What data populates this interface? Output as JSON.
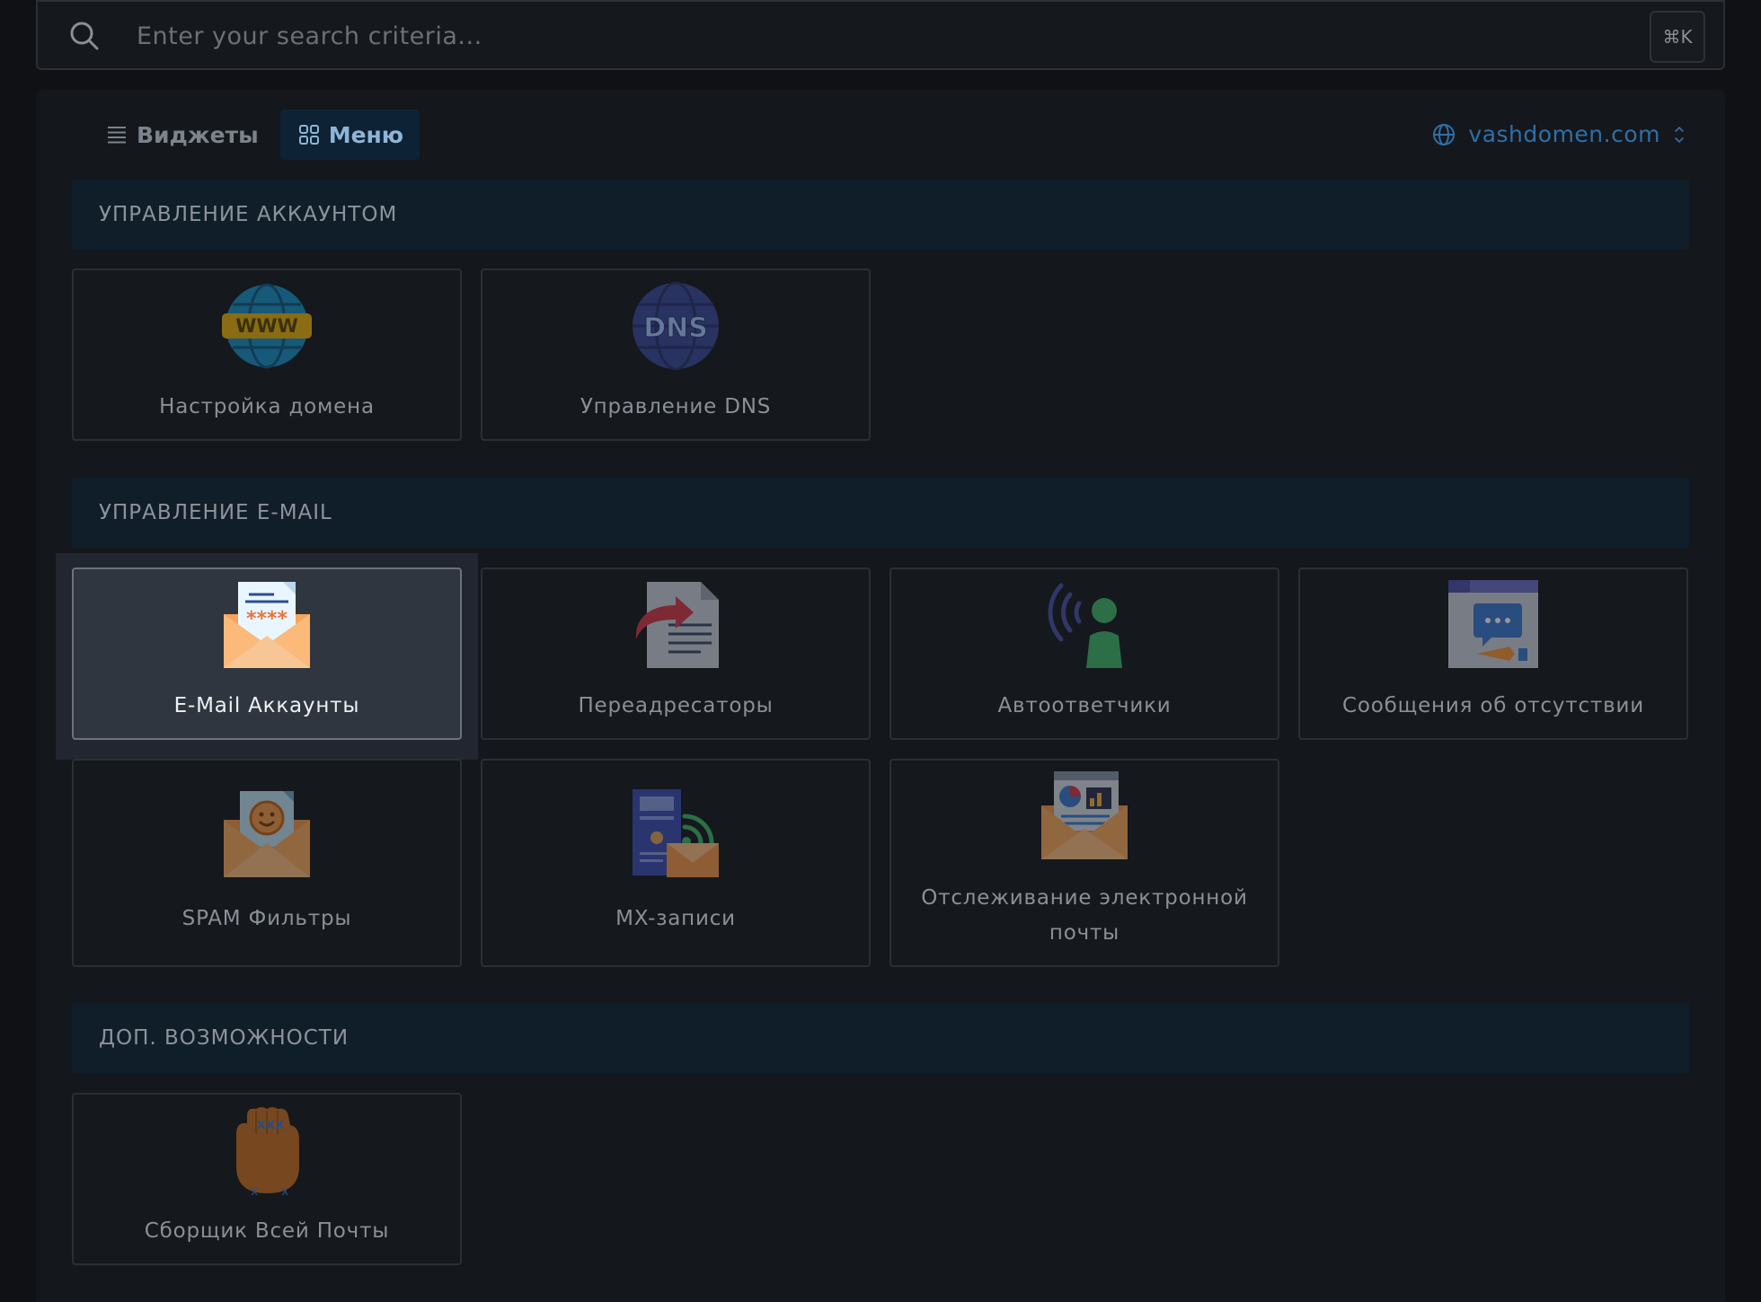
{
  "search": {
    "placeholder": "Enter your search criteria...",
    "shortcut": "⌘K"
  },
  "view_tabs": [
    {
      "label": "Виджеты",
      "icon": "list-icon",
      "active": false
    },
    {
      "label": "Меню",
      "icon": "grid-icon",
      "active": true
    }
  ],
  "domain_selector": {
    "label": "vashdomen.com",
    "icon": "globe-icon"
  },
  "sections": [
    {
      "title": "УПРАВЛЕНИЕ АККАУНТОМ",
      "items": [
        {
          "label": "Настройка домена",
          "icon": "www-globe-icon"
        },
        {
          "label": "Управление DNS",
          "icon": "dns-globe-icon"
        }
      ]
    },
    {
      "title": "УПРАВЛЕНИЕ E-MAIL",
      "items": [
        {
          "label": "E-Mail Аккаунты",
          "icon": "email-password-envelope-icon",
          "selected": true
        },
        {
          "label": "Переадресаторы",
          "icon": "forward-document-icon"
        },
        {
          "label": "Автоответчики",
          "icon": "autoresponder-person-icon"
        },
        {
          "label": "Сообщения об отсутствии",
          "icon": "away-message-icon"
        },
        {
          "label": "SPAM Фильтры",
          "icon": "spam-envelope-icon"
        },
        {
          "label": "MX-записи",
          "icon": "mx-server-icon"
        },
        {
          "label": "Отслеживание электронной почты",
          "icon": "email-tracking-icon"
        }
      ]
    },
    {
      "title": "ДОП. ВОЗМОЖНОСТИ",
      "items": [
        {
          "label": "Сборщик Всей Почты",
          "icon": "catch-all-hand-icon"
        }
      ]
    }
  ]
}
